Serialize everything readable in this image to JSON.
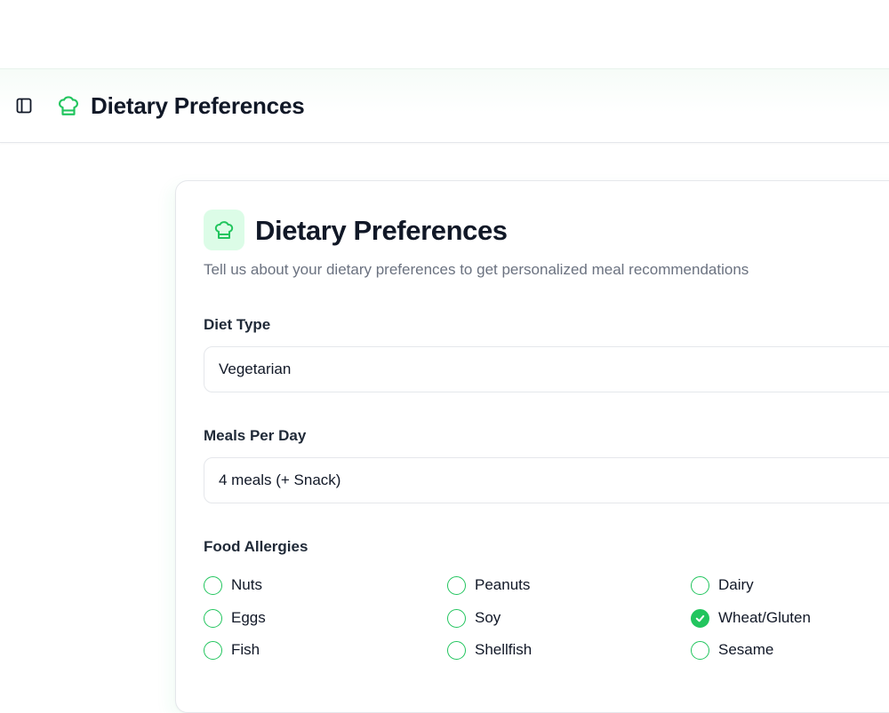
{
  "header": {
    "title": "Dietary Preferences",
    "sidebar_toggle_icon": "sidebar-panel-icon",
    "brand_icon": "chef-hat-icon"
  },
  "card": {
    "title": "Dietary Preferences",
    "subtitle": "Tell us about your dietary preferences to get personalized meal recommendations",
    "icon": "chef-hat-icon"
  },
  "diet_type": {
    "label": "Diet Type",
    "value": "Vegetarian"
  },
  "meals_per_day": {
    "label": "Meals Per Day",
    "value": "4 meals (+ Snack)"
  },
  "allergies": {
    "label": "Food Allergies",
    "items": [
      {
        "label": "Nuts",
        "checked": false
      },
      {
        "label": "Peanuts",
        "checked": false
      },
      {
        "label": "Dairy",
        "checked": false
      },
      {
        "label": "Eggs",
        "checked": false
      },
      {
        "label": "Soy",
        "checked": false
      },
      {
        "label": "Wheat/Gluten",
        "checked": true
      },
      {
        "label": "Fish",
        "checked": false
      },
      {
        "label": "Shellfish",
        "checked": false
      },
      {
        "label": "Sesame",
        "checked": false
      }
    ]
  },
  "colors": {
    "accent": "#22c55e",
    "accent_light": "#dcfce7",
    "text": "#111827",
    "muted": "#6b7280",
    "border": "#e5e7eb"
  }
}
